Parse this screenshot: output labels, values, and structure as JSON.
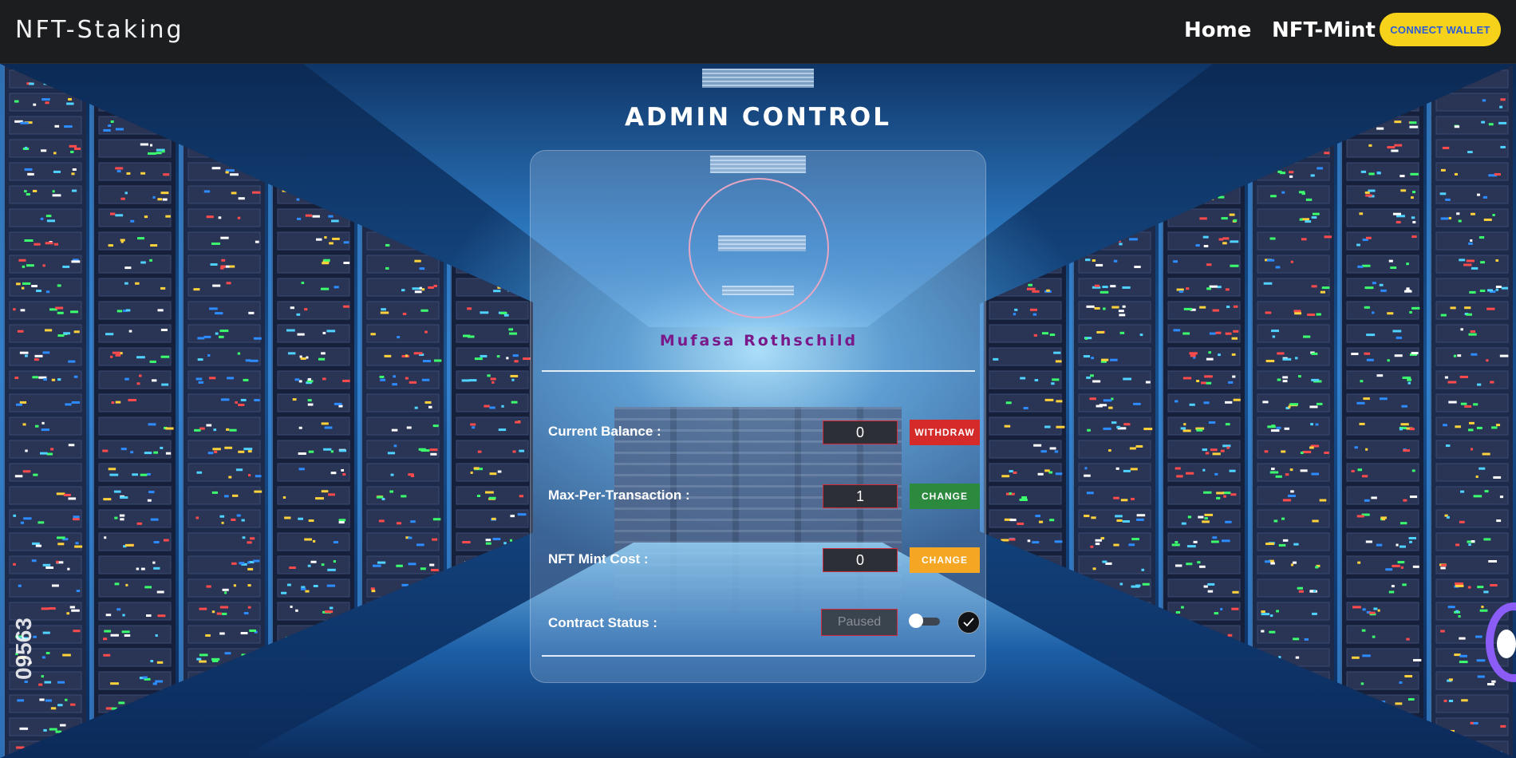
{
  "navbar": {
    "brand": "NFT-Staking",
    "links": [
      "Home",
      "NFT-Mint"
    ],
    "wallet_button": "CONNECT WALLET"
  },
  "page": {
    "title": "ADMIN CONTROL"
  },
  "profile": {
    "name": "Mufasa Rothschild"
  },
  "rows": {
    "balance": {
      "label": "Current Balance :",
      "value": "0",
      "button": "WITHDRAW"
    },
    "max_per_tx": {
      "label": "Max-Per-Transaction :",
      "value": "1",
      "button": "CHANGE"
    },
    "mint_cost": {
      "label": "NFT Mint Cost :",
      "value": "0",
      "button": "CHANGE"
    },
    "contract_status": {
      "label": "Contract Status :",
      "value": "Paused"
    }
  },
  "background": {
    "watermark_number": "09563"
  },
  "colors": {
    "navbar": "#1b1d1f",
    "wallet_button": "#f7d21a",
    "withdraw": "#d42a2a",
    "change_green": "#2b8a3e",
    "change_orange": "#f5a623",
    "name": "#7a1a8a"
  }
}
